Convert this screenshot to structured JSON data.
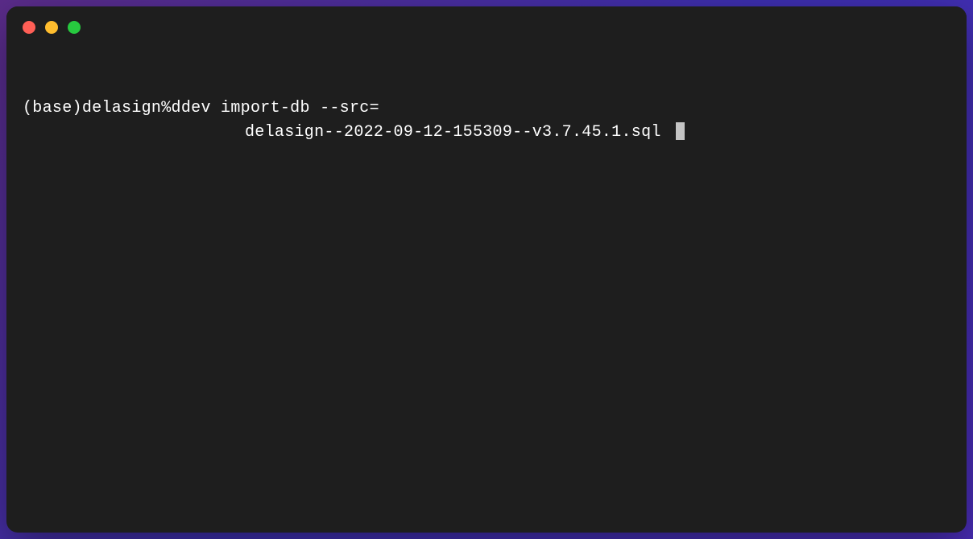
{
  "terminal": {
    "prompt_env": "(base)",
    "prompt_dir": "delasign",
    "prompt_symbol": "%",
    "command_part1": "ddev import-db --src=",
    "command_part2": "delasign--2022-09-12-155309--v3.7.45.1.sql"
  }
}
